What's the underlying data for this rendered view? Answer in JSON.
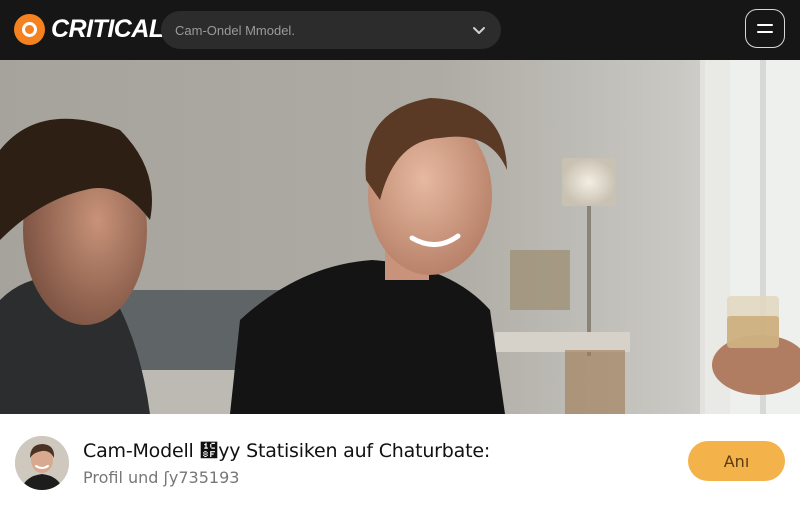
{
  "header": {
    "logo_text": "CRITICAL",
    "select_value": "Cam-Ondel Mmodel."
  },
  "colors": {
    "brand": "#f5821f",
    "cta": "#f4b24a",
    "topbar": "#161616"
  },
  "profile": {
    "title": "Cam-Modell ᲏уу Statisiken auf Chaturbate:",
    "subtitle": "Profil und ʃy735193",
    "action_label": "Anı"
  }
}
